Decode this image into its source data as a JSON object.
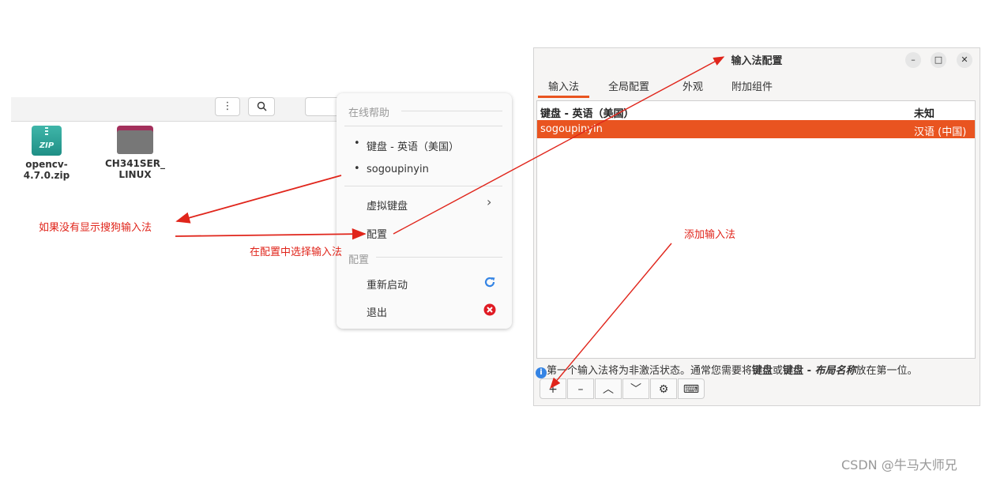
{
  "file_manager": {
    "toolbar": {
      "menu_icon": "vertical-dots-icon",
      "search_icon": "search-icon"
    },
    "files": [
      {
        "name_line1": "opencv-",
        "name_line2": "4.7.0.zip",
        "icon": "zip-archive-icon",
        "icon_label": "ZIP"
      },
      {
        "name_line1": "CH341SER_",
        "name_line2": "LINUX",
        "icon": "folder-icon"
      }
    ]
  },
  "menu": {
    "section_online_help": "在线帮助",
    "input_methods": [
      "键盘 - 英语（美国）",
      "sogoupinyin"
    ],
    "bullet": "•",
    "virtual_keyboard": "虚拟键盘",
    "submenu_arrow": "›",
    "configure": "配置",
    "section_configure": "配置",
    "restart": "重新启动",
    "exit": "退出",
    "colors": {
      "restart_icon": "#3584e4",
      "exit_icon": "#e01b24"
    }
  },
  "window": {
    "title": "输入法配置",
    "controls": {
      "minimize": "–",
      "maximize": "□",
      "close": "✕"
    },
    "tabs": [
      "输入法",
      "全局配置",
      "外观",
      "附加组件"
    ],
    "active_tab": "输入法",
    "list": {
      "header": {
        "name": "键盘 - 英语（美国）",
        "lang": "未知"
      },
      "rows": [
        {
          "name": "sogoupinyin",
          "lang": "汉语 (中国)",
          "selected": true
        }
      ]
    },
    "info": {
      "prefix": "第一个输入法将为非激活状态。通常您需要将",
      "bold1": "键盘",
      "mid": "或",
      "bold2": "键盘 - ",
      "bold_italic": "布局名称",
      "suffix": "放在第一位。"
    },
    "buttons": [
      "+",
      "–",
      "︿",
      "﹀",
      "⚙",
      "⌨"
    ],
    "accent": "#e95420"
  },
  "annotations": {
    "note1": "如果没有显示搜狗输入法",
    "note2": "在配置中选择输入法",
    "note3": "添加输入法",
    "arrow_color": "#e0251b"
  },
  "watermark": "CSDN @牛马大师兄"
}
